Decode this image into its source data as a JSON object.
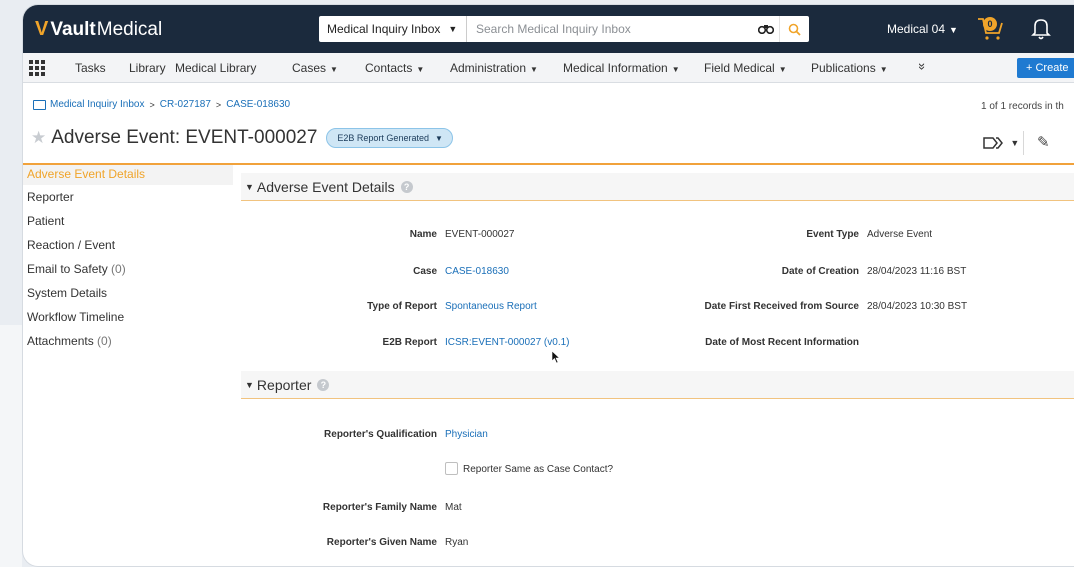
{
  "brand": {
    "logo_v": "V",
    "vault": "Vault",
    "medical": "Medical"
  },
  "search": {
    "scope": "Medical Inquiry Inbox",
    "placeholder": "Search Medical Inquiry Inbox"
  },
  "user": {
    "name": "Medical 04"
  },
  "cart": {
    "count": "0"
  },
  "nav": {
    "items": [
      {
        "label": "Tasks",
        "dropdown": false
      },
      {
        "label": "Library",
        "dropdown": false
      },
      {
        "label": "Medical Library",
        "dropdown": false
      },
      {
        "label": "Cases",
        "dropdown": true
      },
      {
        "label": "Contacts",
        "dropdown": true
      },
      {
        "label": "Administration",
        "dropdown": true
      },
      {
        "label": "Medical Information",
        "dropdown": true
      },
      {
        "label": "Field Medical",
        "dropdown": true
      },
      {
        "label": "Publications",
        "dropdown": true
      }
    ],
    "more": "»",
    "create": "+ Create"
  },
  "breadcrumb": {
    "root": "Medical Inquiry Inbox",
    "level1": "CR-027187",
    "level2": "CASE-018630",
    "sep": ">"
  },
  "records": "1 of 1 records in th",
  "header": {
    "title": "Adverse Event: EVENT-000027",
    "status": "E2B Report Generated"
  },
  "leftnav": [
    {
      "label": "Adverse Event Details",
      "count": ""
    },
    {
      "label": "Reporter",
      "count": ""
    },
    {
      "label": "Patient",
      "count": ""
    },
    {
      "label": "Reaction / Event",
      "count": ""
    },
    {
      "label": "Email to Safety",
      "count": "(0)"
    },
    {
      "label": "System Details",
      "count": ""
    },
    {
      "label": "Workflow Timeline",
      "count": ""
    },
    {
      "label": "Attachments",
      "count": "(0)"
    }
  ],
  "details": {
    "section_title": "Adverse Event Details",
    "name_label": "Name",
    "name_value": "EVENT-000027",
    "case_label": "Case",
    "case_value": "CASE-018630",
    "type_label": "Type of Report",
    "type_value": "Spontaneous Report",
    "e2b_label": "E2B Report",
    "e2b_value": "ICSR:EVENT-000027 (v0.1)",
    "event_type_label": "Event Type",
    "event_type_value": "Adverse Event",
    "creation_label": "Date of Creation",
    "creation_value": "28/04/2023 11:16 BST",
    "first_received_label": "Date First Received from Source",
    "first_received_value": "28/04/2023 10:30 BST",
    "recent_label": "Date of Most Recent Information",
    "recent_value": ""
  },
  "reporter": {
    "section_title": "Reporter",
    "qualification_label": "Reporter's Qualification",
    "qualification_value": "Physician",
    "same_contact_label": "Reporter Same as Case Contact?",
    "family_label": "Reporter's Family Name",
    "family_value": "Mat",
    "given_label": "Reporter's Given Name",
    "given_value": "Ryan"
  }
}
